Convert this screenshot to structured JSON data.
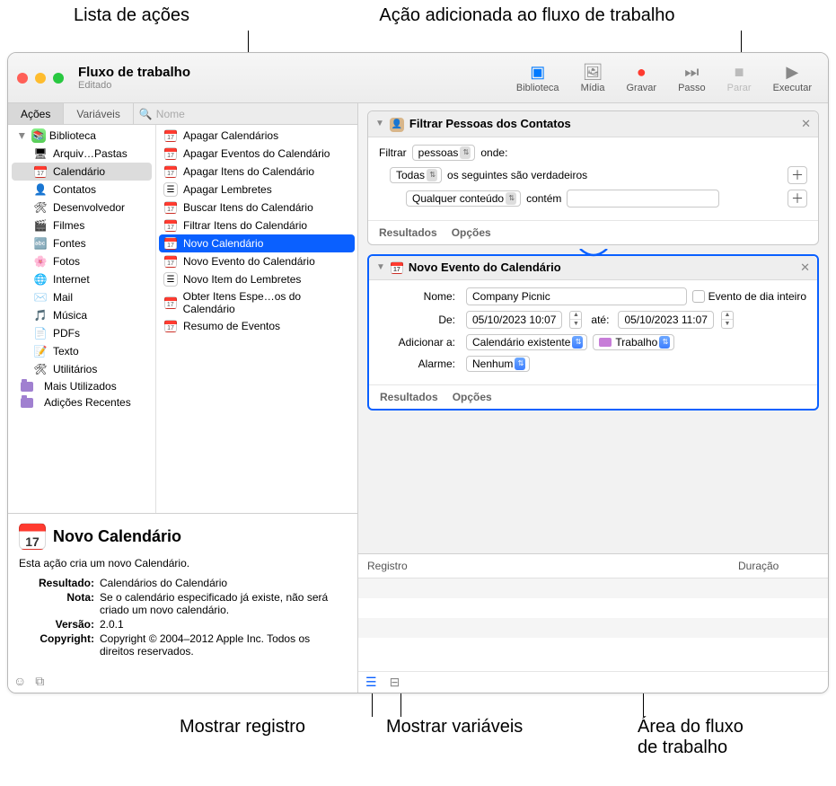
{
  "annotations": {
    "top_left": "Lista de ações",
    "top_right": "Ação adicionada ao fluxo de trabalho",
    "bottom_left": "Mostrar registro",
    "bottom_mid": "Mostrar variáveis",
    "bottom_right": "Área do fluxo\nde trabalho"
  },
  "window": {
    "title": "Fluxo de trabalho",
    "subtitle": "Editado"
  },
  "toolbar": {
    "biblioteca": "Biblioteca",
    "midia": "Mídia",
    "gravar": "Gravar",
    "passo": "Passo",
    "parar": "Parar",
    "executar": "Executar"
  },
  "filterbar": {
    "acoes": "Ações",
    "variaveis": "Variáveis",
    "search_placeholder": "Nome"
  },
  "library_root": "Biblioteca",
  "categories": [
    {
      "label": "Arquiv…Pastas",
      "icon": "finder"
    },
    {
      "label": "Calendário",
      "icon": "calendar",
      "selected": true
    },
    {
      "label": "Contatos",
      "icon": "contacts"
    },
    {
      "label": "Desenvolvedor",
      "icon": "dev"
    },
    {
      "label": "Filmes",
      "icon": "movies"
    },
    {
      "label": "Fontes",
      "icon": "fonts"
    },
    {
      "label": "Fotos",
      "icon": "photos"
    },
    {
      "label": "Internet",
      "icon": "internet"
    },
    {
      "label": "Mail",
      "icon": "mail"
    },
    {
      "label": "Música",
      "icon": "music"
    },
    {
      "label": "PDFs",
      "icon": "pdf"
    },
    {
      "label": "Texto",
      "icon": "text"
    },
    {
      "label": "Utilitários",
      "icon": "util"
    }
  ],
  "smart_folders": [
    {
      "label": "Mais Utilizados"
    },
    {
      "label": "Adições Recentes"
    }
  ],
  "actions": [
    {
      "label": "Apagar Calendários"
    },
    {
      "label": "Apagar Eventos do Calendário"
    },
    {
      "label": "Apagar Itens do Calendário"
    },
    {
      "label": "Apagar Lembretes",
      "icon": "reminders"
    },
    {
      "label": "Buscar Itens do Calendário"
    },
    {
      "label": "Filtrar Itens do Calendário"
    },
    {
      "label": "Novo Calendário",
      "selected": true
    },
    {
      "label": "Novo Evento do Calendário"
    },
    {
      "label": "Novo Item do Lembretes",
      "icon": "reminders"
    },
    {
      "label": "Obter Itens Espe…os do Calendário"
    },
    {
      "label": "Resumo de Eventos"
    }
  ],
  "detail": {
    "title": "Novo Calendário",
    "icon_day": "17",
    "description": "Esta ação cria um novo Calendário.",
    "rows": {
      "resultado_label": "Resultado:",
      "resultado_val": "Calendários do Calendário",
      "nota_label": "Nota:",
      "nota_val": "Se o calendário especificado já existe, não será criado um novo calendário.",
      "versao_label": "Versão:",
      "versao_val": "2.0.1",
      "copyright_label": "Copyright:",
      "copyright_val": "Copyright © 2004–2012 Apple Inc. Todos os direitos reservados."
    }
  },
  "workflow": {
    "card1": {
      "title": "Filtrar Pessoas dos Contatos",
      "filtrar_label": "Filtrar",
      "filtrar_value": "pessoas",
      "onde": "onde:",
      "todas": "Todas",
      "seguintes": "os seguintes são verdadeiros",
      "qualquer": "Qualquer conteúdo",
      "contem": "contém",
      "resultados": "Resultados",
      "opcoes": "Opções"
    },
    "card2": {
      "title": "Novo Evento do Calendário",
      "nome_label": "Nome:",
      "nome_value": "Company Picnic",
      "allday": "Evento de dia inteiro",
      "de_label": "De:",
      "de_value": "05/10/2023 10:07",
      "ate_label": "até:",
      "ate_value": "05/10/2023 11:07",
      "adicionar_label": "Adicionar a:",
      "adicionar_value": "Calendário existente",
      "cal_name": "Trabalho",
      "alarme_label": "Alarme:",
      "alarme_value": "Nenhum",
      "resultados": "Resultados",
      "opcoes": "Opções"
    }
  },
  "log": {
    "registro": "Registro",
    "duracao": "Duração"
  }
}
